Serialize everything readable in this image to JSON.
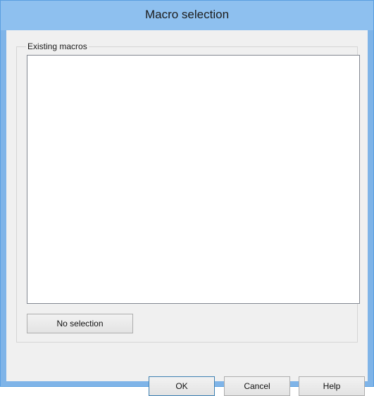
{
  "window": {
    "title": "Macro selection"
  },
  "group": {
    "label": "Existing macros"
  },
  "list": {
    "items": []
  },
  "buttons": {
    "no_selection": "No selection",
    "ok": "OK",
    "cancel": "Cancel",
    "help": "Help"
  },
  "colors": {
    "titlebar": "#8ec0ef",
    "frame": "#7fb4e8",
    "client": "#f0f0f0"
  }
}
